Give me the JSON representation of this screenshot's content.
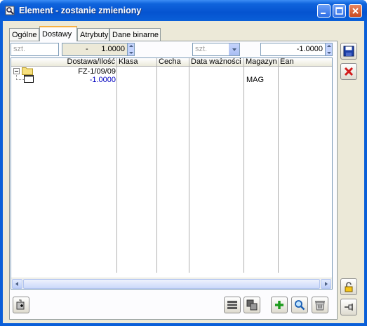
{
  "window": {
    "title": "Element - zostanie zmieniony"
  },
  "tabs": [
    {
      "label": "Ogólne"
    },
    {
      "label": "Dostawy"
    },
    {
      "label": "Atrybuty"
    },
    {
      "label": "Dane binarne"
    }
  ],
  "active_tab": "Dostawy",
  "filters": {
    "unit_left": "szt.",
    "quantity_left": "1.0000",
    "quantity_left_prefix": "-",
    "unit_combo": "szt.",
    "quantity_right": "-1.0000"
  },
  "grid": {
    "columns": [
      "Dostawa/Ilość",
      "Klasa",
      "Cecha",
      "Data ważności",
      "Magazyn",
      "Ean"
    ],
    "rows": [
      {
        "delivery": "FZ-1/09/09",
        "klasa": "",
        "cecha": "",
        "data": "",
        "magazyn": "",
        "ean": ""
      },
      {
        "delivery": "-1.0000",
        "klasa": "",
        "cecha": "",
        "data": "",
        "magazyn": "MAG",
        "ean": ""
      }
    ]
  },
  "colors": {
    "titlebar": "#0a5fd8",
    "tab_highlight": "#f9b03f",
    "quantity_blue": "#0000c0"
  }
}
